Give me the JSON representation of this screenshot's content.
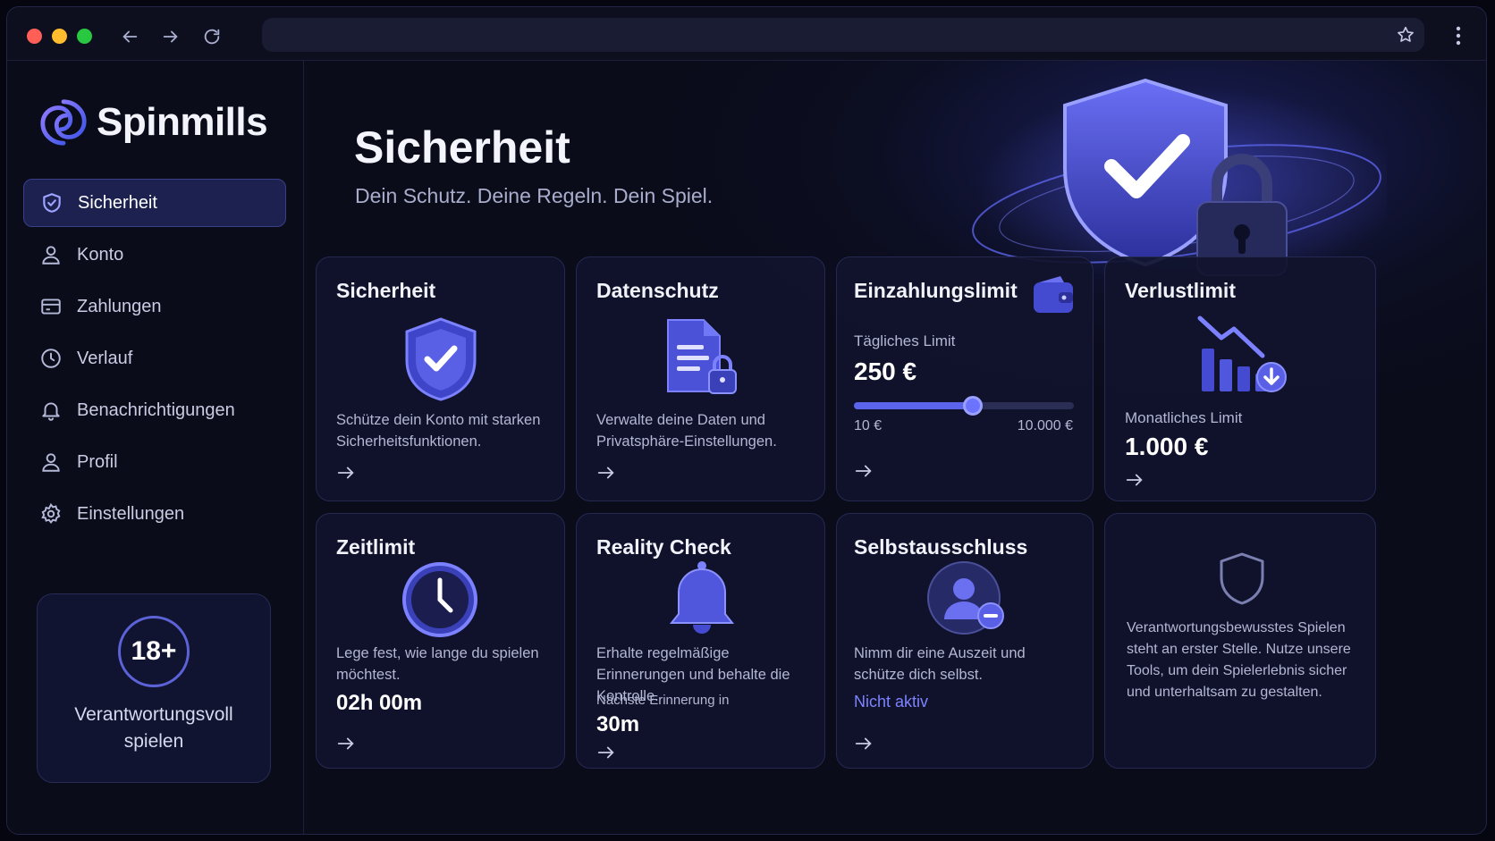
{
  "app": {
    "brand": "Spinmills"
  },
  "sidebar": {
    "items": [
      {
        "label": "Sicherheit",
        "icon": "shield-check-icon",
        "active": true
      },
      {
        "label": "Konto",
        "icon": "user-icon"
      },
      {
        "label": "Zahlungen",
        "icon": "credit-card-icon"
      },
      {
        "label": "Verlauf",
        "icon": "clock-icon"
      },
      {
        "label": "Benachrichtigungen",
        "icon": "bell-icon"
      },
      {
        "label": "Profil",
        "icon": "user-icon"
      },
      {
        "label": "Einstellungen",
        "icon": "gear-icon"
      }
    ],
    "age_badge": "18+",
    "age_text_line1": "Verantwortungsvoll",
    "age_text_line2": "spielen"
  },
  "header": {
    "title": "Sicherheit",
    "subtitle": "Dein Schutz. Deine Regeln. Dein Spiel."
  },
  "cards": {
    "security": {
      "title": "Sicherheit",
      "desc": "Schütze dein Konto mit starken Sicherheitsfunktionen."
    },
    "privacy": {
      "title": "Datenschutz",
      "desc": "Verwalte deine Daten und Privatsphäre-Einstellungen."
    },
    "deposit": {
      "title": "Einzahlungslimit",
      "label": "Tägliches Limit",
      "value": "250 €",
      "min": "10 €",
      "max": "10.000 €",
      "slider_fraction": 0.54
    },
    "loss": {
      "title": "Verlustlimit",
      "label": "Monatliches Limit",
      "value": "1.000 €"
    },
    "time": {
      "title": "Zeitlimit",
      "desc": "Lege fest, wie lange du spielen möchtest.",
      "value": "02h 00m"
    },
    "reality": {
      "title": "Reality Check",
      "desc": "Erhalte regelmäßige Erinnerungen und behalte die Kontrolle.",
      "label": "Nächste Erinnerung in",
      "value": "30m"
    },
    "exclusion": {
      "title": "Selbstausschluss",
      "desc": "Nimm dir eine Auszeit und schütze dich selbst.",
      "status": "Nicht aktiv"
    },
    "info": {
      "text": "Verantwortungsbewusstes Spielen steht an erster Stelle. Nutze unsere Tools, um dein Spielerlebnis sicher und unterhaltsam zu gestalten."
    }
  },
  "colors": {
    "accent": "#5b63ea",
    "link": "#7d84ff",
    "background": "#0b0d1c"
  }
}
